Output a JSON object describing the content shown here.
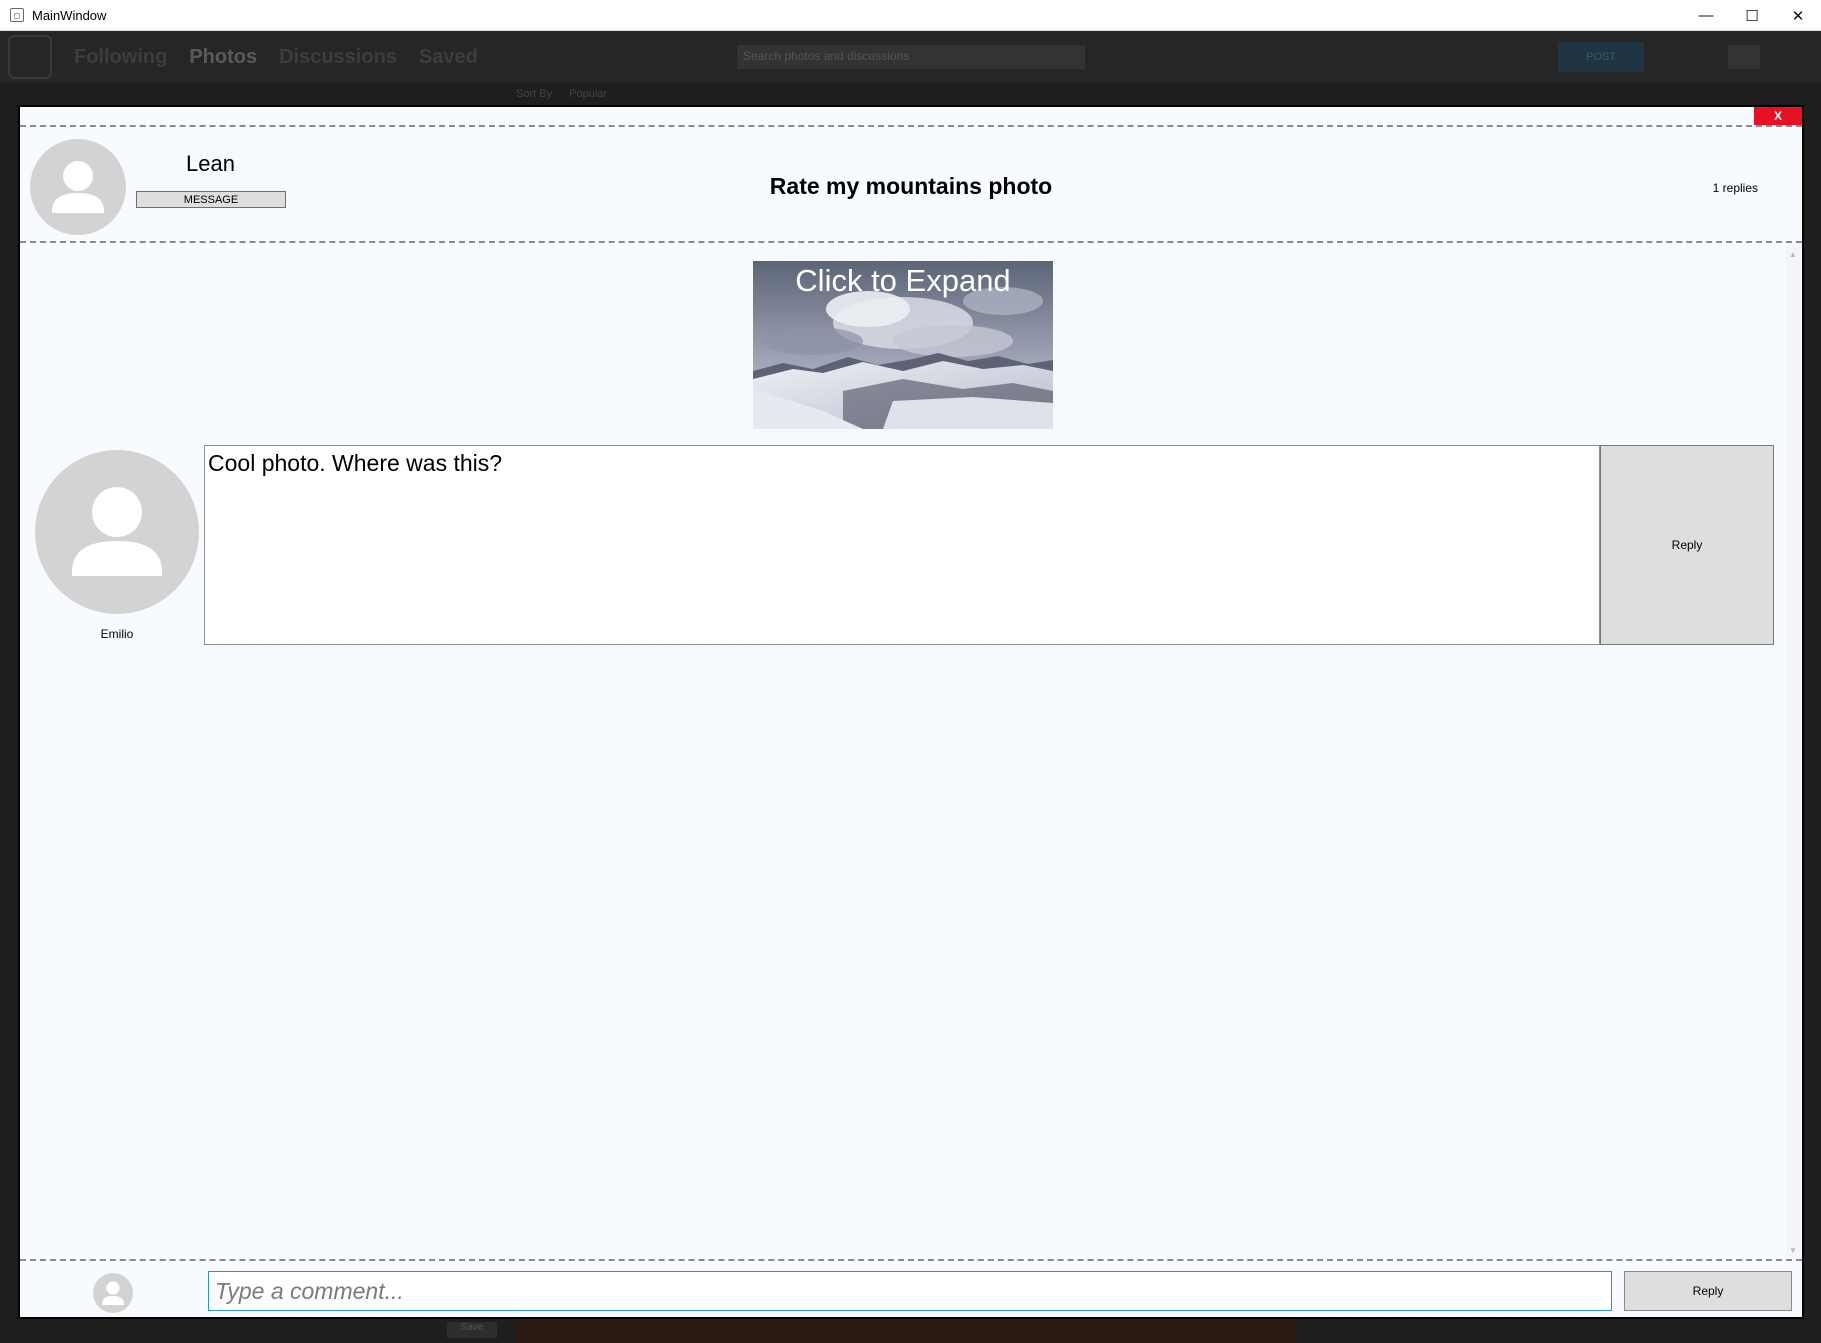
{
  "window": {
    "title": "MainWindow",
    "minimize_glyph": "—",
    "maximize_glyph": "☐",
    "close_glyph": "✕"
  },
  "background_app": {
    "nav": [
      "Following",
      "Photos",
      "Discussions",
      "Saved"
    ],
    "active_nav": "Photos",
    "search_placeholder": "Search photos and discussions",
    "post_label": "POST",
    "sort_label": "Sort By",
    "sort_value": "Popular",
    "bottom_button": "Save"
  },
  "modal": {
    "close_label": "X",
    "author": {
      "name": "Lean",
      "message_label": "MESSAGE",
      "avatar_icon": "user-silhouette-icon"
    },
    "post_title": "Rate my mountains photo",
    "replies_count": "1 replies",
    "photo": {
      "overlay_label": "Click to Expand",
      "subject": "snowy mountains under cloudy sky"
    },
    "comments": [
      {
        "author": "Emilio",
        "text": "Cool photo. Where was this?",
        "reply_label": "Reply"
      }
    ],
    "footer": {
      "input_placeholder": "Type a comment...",
      "input_value": "",
      "reply_label": "Reply"
    }
  },
  "colors": {
    "modal_bg": "#f7faff",
    "close_red": "#e81123",
    "avatar_gray": "#d3d3d3",
    "button_gray": "#dedede",
    "input_focus": "#2c8fd6"
  }
}
